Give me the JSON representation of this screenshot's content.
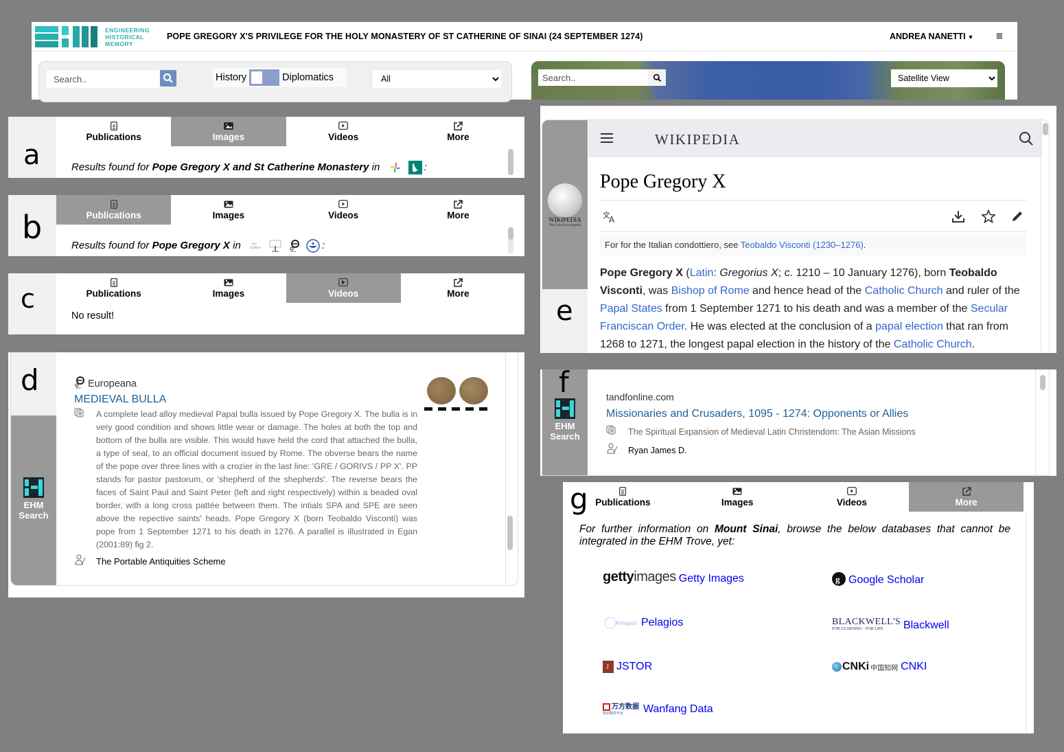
{
  "header": {
    "logo_lines": [
      "ENGINEERING",
      "HISTORICAL",
      "MEMORY"
    ],
    "title": "POPE GREGORY X'S PRIVILEGE FOR THE HOLY MONASTERY OF ST CATHERINE OF SINAI (24 SEPTEMBER 1274)",
    "user": "ANDREA NANETTI",
    "search_placeholder": "Search..",
    "toggle_left": "History",
    "toggle_right": "Diplomatics",
    "filter_selected": "All",
    "map_search_placeholder": "Search..",
    "map_view_selected": "Satellite View"
  },
  "tabs": [
    "Publications",
    "Images",
    "Videos",
    "More"
  ],
  "panel_a": {
    "letter": "a",
    "active_tab": "Images",
    "prefix": "Results found for ",
    "query": "Pope Gregory X and St Catherine Monastery",
    "in": " in",
    "sources": [
      "google-photos",
      "bing"
    ],
    "suffix": ":"
  },
  "panel_b": {
    "letter": "b",
    "active_tab": "Publications",
    "prefix": "Results found for ",
    "query": "Pope Gregory X",
    "in": " in",
    "sources": [
      "gallica",
      "library-tree",
      "europeana",
      "water-drop"
    ],
    "suffix": ":"
  },
  "panel_c": {
    "letter": "c",
    "active_tab": "Videos",
    "message": "No result!"
  },
  "panel_d": {
    "letter": "d",
    "side_label_1": "EHM",
    "side_label_2": "Search",
    "source": "Europeana",
    "title": "MEDIEVAL BULLA",
    "description": "A complete lead alloy medieval Papal bulla issued by Pope Gregory X. The bulla is in very good condition and shows little wear or damage. The holes at both the top and bottom of the bulla are visible. This would have held the cord that attached the bulla, a type of seal, to an official document issued by Rome. The obverse bears the name of the pope over three lines with a crozier in the last line: 'GRE / GORIVS / PP X'. PP stands for pastor pastorum, or 'shepherd of the shepherds'. The reverse bears the faces of Saint Paul and Saint Peter (left and right respectively) within a beaded oval border, with a long cross pattée between them. The intials SPA and SPE are seen above the repective saints' heads. Pope Gregory X (born Teobaldo Visconti) was pope from 1 September 1271 to his death in 1276. A parallel is illustrated in Egan (2001:89) fig 2.",
    "author": "The Portable Antiquities Scheme"
  },
  "panel_e": {
    "letter": "e",
    "side_caption": "WIKIPEDIA",
    "side_subcaption": "The Free Encyclopedia",
    "wordmark": "WIKIPEDIA",
    "title": "Pope Gregory X",
    "hatnote_prefix": "For for the Italian condottiero, see ",
    "hatnote_link": "Teobaldo Visconti (1230–1276)",
    "hatnote_suffix": ".",
    "para": {
      "t1": "Pope Gregory X",
      "t2": " (",
      "l1": "Latin",
      "t3": ": ",
      "t4": "Gregorius X",
      "t5": "; c. 1210 – 10 January 1276), born ",
      "t6": "Teobaldo Visconti",
      "t7": ", was ",
      "l2": "Bishop of Rome",
      "t8": " and hence head of the ",
      "l3": "Catholic Church",
      "t9": " and ruler of the ",
      "l4": "Papal States",
      "t10": " from 1 September 1271 to his death and was a member of the ",
      "l5": "Secular Franciscan Order",
      "t11": ". He was elected at the conclusion of a ",
      "l6": "papal election",
      "t12": " that ran from 1268 to 1271, the longest papal election in the history of the ",
      "l7": "Catholic Church",
      "t13": "."
    }
  },
  "panel_f": {
    "letter": "f",
    "side_label_1": "EHM",
    "side_label_2": "Search",
    "source": "tandfonline.com",
    "title": "Missionaries and Crusaders, 1095 - 1274: Opponents or Allies",
    "description": "The Spiritual Expansion of Medieval Latin Christendom: The Asian Missions",
    "author": "Ryan James D."
  },
  "panel_g": {
    "letter": "g",
    "active_tab": "More",
    "intro_1": "For further information on ",
    "intro_bold": "Mount Sinai",
    "intro_2": ", browse the below databases that cannot be integrated in the EHM Trove, yet:",
    "databases": [
      {
        "logo": "gettyimages",
        "label": "Getty Images"
      },
      {
        "logo": "google-scholar",
        "label": "Google Scholar"
      },
      {
        "logo": "pelagios",
        "label": "Pelagios"
      },
      {
        "logo": "blackwells",
        "label": "Blackwell"
      },
      {
        "logo": "jstor",
        "label": "JSTOR"
      },
      {
        "logo": "cnki",
        "label": "CNKI"
      },
      {
        "logo": "wanfang",
        "label": "Wanfang Data"
      }
    ],
    "logo_text": {
      "getty_bold": "getty",
      "getty_light": "images",
      "blackwells_top": "BLACKWELL'S",
      "blackwells_bottom": "FOR LEARNING · FOR LIFE",
      "cnki": "CNKi",
      "wanfang": "万方数据"
    }
  },
  "colors": {
    "background": "#808080",
    "active_tab": "#999999",
    "teal": "#2bb3b1",
    "result_title": "#1f5f9a",
    "wiki_link": "#3366cc",
    "db_link": "#0000ee"
  }
}
